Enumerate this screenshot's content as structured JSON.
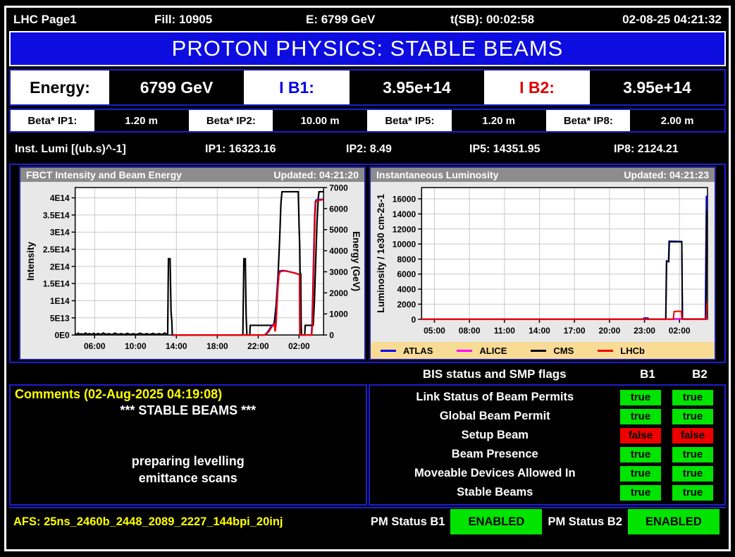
{
  "colors": {
    "title_band": "#0d0de0",
    "section_border": "#1d1dcf",
    "status_green": "#00e400",
    "status_red": "#ee0000",
    "comment_yellow": "#ffff00",
    "legend_bg": "#f8dc96"
  },
  "topbar": {
    "page": "LHC Page1",
    "fill": "Fill: 10905",
    "energy": "E:   6799 GeV",
    "tsb": "t(SB): 00:02:58",
    "datetime": "02-08-25 04:21:32"
  },
  "title": "PROTON PHYSICS: STABLE BEAMS",
  "energy_row": {
    "label": "Energy:",
    "value": "6799 GeV",
    "ib1_label": "I B1:",
    "ib1_value": "3.95e+14",
    "ib2_label": "I B2:",
    "ib2_value": "3.95e+14"
  },
  "beta_row": {
    "items": [
      {
        "label": "Beta* IP1:",
        "value": "1.20 m"
      },
      {
        "label": "Beta* IP2:",
        "value": "10.00 m"
      },
      {
        "label": "Beta* IP5:",
        "value": "1.20 m"
      },
      {
        "label": "Beta* IP8:",
        "value": "2.00 m"
      }
    ]
  },
  "lumi_row": {
    "title": "Inst. Lumi [(ub.s)^-1]",
    "ip1": "IP1: 16323.16",
    "ip2": "IP2:    8.49",
    "ip5": "IP5: 14351.95",
    "ip8": "IP8:  2124.21"
  },
  "chart_data": [
    {
      "type": "line",
      "title": "FBCT Intensity and Beam Energy",
      "updated": "Updated: 04:21:20",
      "x": {
        "min": 4.1,
        "max": 28.4,
        "ticks": [
          {
            "v": 6,
            "label": "06:00"
          },
          {
            "v": 10,
            "label": "10:00"
          },
          {
            "v": 14,
            "label": "14:00"
          },
          {
            "v": 18,
            "label": "18:00"
          },
          {
            "v": 22,
            "label": "22:00"
          },
          {
            "v": 26,
            "label": "02:00"
          }
        ]
      },
      "y": {
        "min": 0,
        "max": 4.3,
        "label": "Intensity",
        "units": "1e14 charges",
        "ticks": [
          {
            "v": 0,
            "label": "0E0"
          },
          {
            "v": 0.5,
            "label": "5E13"
          },
          {
            "v": 1,
            "label": "1E14"
          },
          {
            "v": 1.5,
            "label": "1.5E14"
          },
          {
            "v": 2,
            "label": "2E14"
          },
          {
            "v": 2.5,
            "label": "2.5E14"
          },
          {
            "v": 3,
            "label": "3E14"
          },
          {
            "v": 3.5,
            "label": "3.5E14"
          },
          {
            "v": 4,
            "label": "4E14"
          }
        ]
      },
      "y2": {
        "min": 0,
        "max": 7000,
        "label": "Energy (GeV)",
        "ticks": [
          {
            "v": 0,
            "label": "0"
          },
          {
            "v": 1000,
            "label": "1000"
          },
          {
            "v": 2000,
            "label": "2000"
          },
          {
            "v": 3000,
            "label": "3000"
          },
          {
            "v": 4000,
            "label": "4000"
          },
          {
            "v": 5000,
            "label": "5000"
          },
          {
            "v": 6000,
            "label": "6000"
          },
          {
            "v": 7000,
            "label": "7000"
          }
        ]
      },
      "series": [
        {
          "name": "Beam Energy",
          "color": "#000000",
          "axis": "y2",
          "width": 2.2,
          "points": [
            [
              4.1,
              60
            ],
            [
              4.25,
              15
            ],
            [
              4.4,
              85
            ],
            [
              4.55,
              25
            ],
            [
              4.7,
              60
            ],
            [
              4.9,
              20
            ],
            [
              5.1,
              95
            ],
            [
              5.3,
              30
            ],
            [
              5.5,
              65
            ],
            [
              5.7,
              20
            ],
            [
              5.9,
              80
            ],
            [
              6.1,
              25
            ],
            [
              6.35,
              70
            ],
            [
              6.6,
              20
            ],
            [
              6.85,
              90
            ],
            [
              7.1,
              30
            ],
            [
              7.4,
              55
            ],
            [
              7.7,
              20
            ],
            [
              8.0,
              85
            ],
            [
              8.3,
              25
            ],
            [
              8.6,
              60
            ],
            [
              8.9,
              20
            ],
            [
              9.2,
              75
            ],
            [
              9.5,
              25
            ],
            [
              9.8,
              55
            ],
            [
              10.1,
              20
            ],
            [
              10.45,
              80
            ],
            [
              10.8,
              25
            ],
            [
              11.1,
              60
            ],
            [
              11.4,
              20
            ],
            [
              11.7,
              75
            ],
            [
              12.0,
              25
            ],
            [
              12.3,
              60
            ],
            [
              12.6,
              20
            ],
            [
              12.85,
              90
            ],
            [
              13.05,
              40
            ],
            [
              13.15,
              50
            ],
            [
              13.22,
              3620
            ],
            [
              13.38,
              3620
            ],
            [
              13.48,
              1100
            ],
            [
              13.55,
              650
            ],
            [
              13.6,
              0
            ],
            [
              20.5,
              0
            ],
            [
              20.6,
              3620
            ],
            [
              20.74,
              3620
            ],
            [
              20.82,
              900
            ],
            [
              20.9,
              0
            ],
            [
              21.18,
              0
            ],
            [
              21.22,
              455
            ],
            [
              23.52,
              455
            ],
            [
              23.6,
              700
            ],
            [
              23.75,
              1400
            ],
            [
              23.95,
              2900
            ],
            [
              24.1,
              4600
            ],
            [
              24.22,
              6200
            ],
            [
              24.32,
              6800
            ],
            [
              25.92,
              6800
            ],
            [
              26.0,
              5200
            ],
            [
              26.06,
              4300
            ],
            [
              26.1,
              2900
            ],
            [
              26.16,
              2900
            ],
            [
              26.2,
              455
            ],
            [
              26.24,
              0
            ],
            [
              26.55,
              0
            ],
            [
              26.6,
              455
            ],
            [
              27.38,
              455
            ],
            [
              27.5,
              1600
            ],
            [
              27.62,
              3400
            ],
            [
              27.75,
              5300
            ],
            [
              27.88,
              6500
            ],
            [
              27.95,
              6800
            ],
            [
              28.4,
              6800
            ]
          ]
        },
        {
          "name": "Intensity B1",
          "color": "#0000ee",
          "axis": "y",
          "width": 2,
          "points": [
            [
              13.58,
              0
            ],
            [
              22.6,
              0
            ],
            [
              22.8,
              0.05
            ],
            [
              23.0,
              0.12
            ],
            [
              23.2,
              0.22
            ],
            [
              23.42,
              0.3
            ],
            [
              23.58,
              0.33
            ],
            [
              23.64,
              0.12
            ],
            [
              23.7,
              0.3
            ],
            [
              23.8,
              0.85
            ],
            [
              23.9,
              1.45
            ],
            [
              24.0,
              1.78
            ],
            [
              24.12,
              1.87
            ],
            [
              24.5,
              1.88
            ],
            [
              24.9,
              1.86
            ],
            [
              25.3,
              1.83
            ],
            [
              25.7,
              1.8
            ],
            [
              25.98,
              1.77
            ],
            [
              26.04,
              1.76
            ],
            [
              26.07,
              0
            ],
            [
              27.2,
              0
            ],
            [
              27.27,
              0.35
            ],
            [
              27.34,
              1.3
            ],
            [
              27.43,
              2.5
            ],
            [
              27.52,
              3.5
            ],
            [
              27.6,
              3.9
            ],
            [
              27.68,
              3.94
            ],
            [
              28.4,
              3.96
            ]
          ]
        },
        {
          "name": "Intensity B2",
          "color": "#ee0000",
          "axis": "y",
          "width": 2.2,
          "points": [
            [
              13.62,
              0
            ],
            [
              22.65,
              0
            ],
            [
              22.85,
              0.04
            ],
            [
              23.05,
              0.1
            ],
            [
              23.25,
              0.2
            ],
            [
              23.46,
              0.29
            ],
            [
              23.6,
              0.32
            ],
            [
              23.66,
              0.1
            ],
            [
              23.73,
              0.27
            ],
            [
              23.83,
              0.8
            ],
            [
              23.93,
              1.4
            ],
            [
              24.03,
              1.75
            ],
            [
              24.15,
              1.85
            ],
            [
              24.55,
              1.87
            ],
            [
              24.95,
              1.85
            ],
            [
              25.35,
              1.82
            ],
            [
              25.75,
              1.79
            ],
            [
              26.0,
              1.76
            ],
            [
              26.06,
              1.75
            ],
            [
              26.09,
              0
            ],
            [
              27.23,
              0
            ],
            [
              27.3,
              0.3
            ],
            [
              27.37,
              1.2
            ],
            [
              27.46,
              2.4
            ],
            [
              27.55,
              3.4
            ],
            [
              27.63,
              3.86
            ],
            [
              27.71,
              3.92
            ],
            [
              28.4,
              3.95
            ]
          ]
        }
      ]
    },
    {
      "type": "line",
      "title": "Instantaneous Luminosity",
      "updated": "Updated: 04:21:23",
      "x": {
        "min": 3.9,
        "max": 28.4,
        "ticks": [
          {
            "v": 5,
            "label": "05:00"
          },
          {
            "v": 8,
            "label": "08:00"
          },
          {
            "v": 11,
            "label": "11:00"
          },
          {
            "v": 14,
            "label": "14:00"
          },
          {
            "v": 17,
            "label": "17:00"
          },
          {
            "v": 20,
            "label": "20:00"
          },
          {
            "v": 23,
            "label": "23:00"
          },
          {
            "v": 26,
            "label": "02:00"
          }
        ]
      },
      "y": {
        "min": 0,
        "max": 17500,
        "label": "Luminosity / 1e30 cm-2s-1",
        "ticks": [
          {
            "v": 0,
            "label": "0"
          },
          {
            "v": 2000,
            "label": "2000"
          },
          {
            "v": 4000,
            "label": "4000"
          },
          {
            "v": 6000,
            "label": "6000"
          },
          {
            "v": 8000,
            "label": "8000"
          },
          {
            "v": 10000,
            "label": "10000"
          },
          {
            "v": 12000,
            "label": "12000"
          },
          {
            "v": 14000,
            "label": "14000"
          },
          {
            "v": 16000,
            "label": "16000"
          }
        ]
      },
      "legend": [
        {
          "name": "ATLAS",
          "color": "#0000ee"
        },
        {
          "name": "ALICE",
          "color": "#ff00ff"
        },
        {
          "name": "CMS",
          "color": "#000000"
        },
        {
          "name": "LHCb",
          "color": "#ee0000"
        }
      ],
      "series": [
        {
          "name": "ATLAS",
          "color": "#0000ee",
          "axis": "y",
          "width": 2,
          "points": [
            [
              3.9,
              30
            ],
            [
              22.88,
              30
            ],
            [
              22.95,
              160
            ],
            [
              23.3,
              160
            ],
            [
              23.36,
              30
            ],
            [
              24.82,
              30
            ],
            [
              24.88,
              7750
            ],
            [
              25.06,
              7700
            ],
            [
              25.11,
              10380
            ],
            [
              25.6,
              10360
            ],
            [
              26.2,
              10340
            ],
            [
              26.26,
              40
            ],
            [
              28.22,
              40
            ],
            [
              28.3,
              16323
            ],
            [
              28.4,
              16323
            ]
          ]
        },
        {
          "name": "ALICE",
          "color": "#ff00ff",
          "axis": "y",
          "width": 2,
          "points": [
            [
              3.9,
              5
            ],
            [
              25.5,
              5
            ],
            [
              25.56,
              60
            ],
            [
              26.18,
              60
            ],
            [
              26.24,
              5
            ],
            [
              28.3,
              5
            ],
            [
              28.36,
              8
            ],
            [
              28.4,
              8
            ]
          ]
        },
        {
          "name": "CMS",
          "color": "#000000",
          "axis": "y",
          "width": 2,
          "points": [
            [
              3.9,
              15
            ],
            [
              24.83,
              15
            ],
            [
              24.9,
              7700
            ],
            [
              25.08,
              7650
            ],
            [
              25.13,
              10300
            ],
            [
              26.2,
              10280
            ],
            [
              26.25,
              15
            ],
            [
              28.26,
              15
            ],
            [
              28.34,
              14352
            ],
            [
              28.4,
              14352
            ]
          ]
        },
        {
          "name": "LHCb",
          "color": "#ee0000",
          "axis": "y",
          "width": 2,
          "points": [
            [
              3.9,
              8
            ],
            [
              25.48,
              8
            ],
            [
              25.54,
              1000
            ],
            [
              25.8,
              1070
            ],
            [
              26.16,
              1050
            ],
            [
              26.21,
              8
            ],
            [
              28.28,
              8
            ],
            [
              28.36,
              2124
            ],
            [
              28.4,
              2124
            ]
          ]
        }
      ]
    }
  ],
  "bis_panel": {
    "header": "BIS status and SMP flags",
    "col_b1": "B1",
    "col_b2": "B2",
    "rows": [
      {
        "label": "Link Status of Beam Permits",
        "b1": "true",
        "b2": "true"
      },
      {
        "label": "Global Beam Permit",
        "b1": "true",
        "b2": "true"
      },
      {
        "label": "Setup Beam",
        "b1": "false",
        "b2": "false"
      },
      {
        "label": "Beam Presence",
        "b1": "true",
        "b2": "true"
      },
      {
        "label": "Moveable Devices Allowed In",
        "b1": "true",
        "b2": "true"
      },
      {
        "label": "Stable Beams",
        "b1": "true",
        "b2": "true"
      }
    ]
  },
  "comments": {
    "title": "Comments (02-Aug-2025 04:19:08)",
    "body": "*** STABLE BEAMS ***\n\n\npreparing levelling\nemittance scans"
  },
  "footer": {
    "afs": "AFS: 25ns_2460b_2448_2089_2227_144bpi_20inj",
    "pm_b1_label": "PM Status B1",
    "pm_b1_value": "ENABLED",
    "pm_b2_label": "PM Status B2",
    "pm_b2_value": "ENABLED"
  }
}
